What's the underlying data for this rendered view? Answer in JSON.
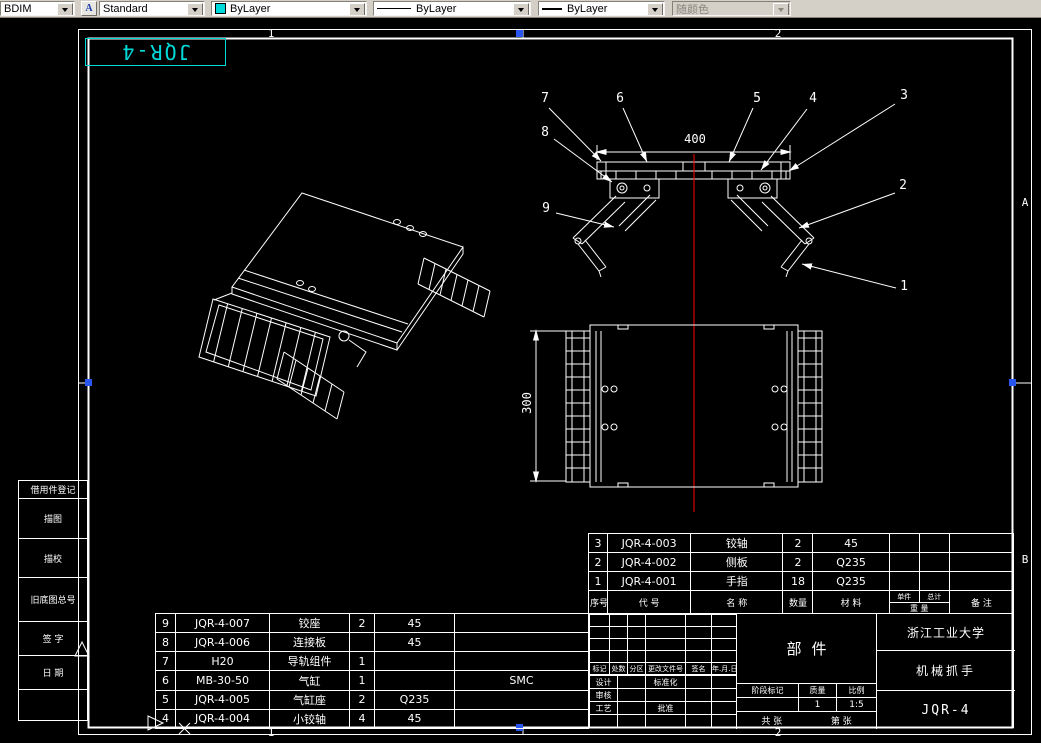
{
  "toolbar": {
    "dim_style": "BDIM",
    "text_style_icon": "A",
    "text_style": "Standard",
    "color": "ByLayer",
    "linetype": "ByLayer",
    "lineweight": "ByLayer",
    "plot_style": "随颜色"
  },
  "sheet": {
    "corner_label": "JQR-4",
    "zones_top": [
      "1",
      "2"
    ],
    "zones_bottom": [
      "1",
      "2"
    ],
    "zones_right": [
      "A",
      "B"
    ]
  },
  "dims": {
    "front_width": "400",
    "plan_depth": "300"
  },
  "balloons": [
    "1",
    "2",
    "3",
    "4",
    "5",
    "6",
    "7",
    "8",
    "9"
  ],
  "border_fields": [
    "借用件登记",
    "描图",
    "描校",
    "旧底图总号",
    "签 字",
    "日 期"
  ],
  "bom_left": {
    "rows": [
      [
        "9",
        "JQR-4-007",
        "铰座",
        "2",
        "45",
        ""
      ],
      [
        "8",
        "JQR-4-006",
        "连接板",
        "",
        "45",
        ""
      ],
      [
        "7",
        "H20",
        "导轨组件",
        "1",
        "",
        ""
      ],
      [
        "6",
        "MB-30-50",
        "气缸",
        "1",
        "",
        "SMC"
      ],
      [
        "5",
        "JQR-4-005",
        "气缸座",
        "2",
        "Q235",
        ""
      ],
      [
        "4",
        "JQR-4-004",
        "小铰轴",
        "4",
        "45",
        ""
      ]
    ]
  },
  "bom_right": {
    "rows": [
      [
        "3",
        "JQR-4-003",
        "铰轴",
        "2",
        "45",
        "",
        "",
        ""
      ],
      [
        "2",
        "JQR-4-002",
        "侧板",
        "2",
        "Q235",
        "",
        "",
        ""
      ],
      [
        "1",
        "JQR-4-001",
        "手指",
        "18",
        "Q235",
        "",
        "",
        ""
      ]
    ],
    "header": {
      "no": "序号",
      "code": "代 号",
      "name": "名 称",
      "qty": "数量",
      "material": "材 料",
      "unit": "单件",
      "total": "总计",
      "weight": "重 量",
      "note": "备 注"
    }
  },
  "title_block": {
    "revision_rows": [
      [
        "",
        "",
        "",
        "",
        "",
        ""
      ],
      [
        "",
        "",
        "",
        "",
        "",
        ""
      ],
      [
        "",
        "",
        "",
        "",
        "",
        ""
      ],
      [
        "",
        "",
        "",
        "",
        "",
        ""
      ],
      [
        "标记",
        "处数",
        "分区",
        "更改文件号",
        "签名",
        "年.月.日"
      ]
    ],
    "signature_rows": [
      [
        "设计",
        "",
        "标准化",
        "",
        ""
      ],
      [
        "审核",
        "",
        "",
        "",
        ""
      ],
      [
        "工艺",
        "",
        "批准",
        "",
        ""
      ],
      [
        "",
        "",
        "",
        "",
        ""
      ]
    ],
    "stage_label": "阶段标记",
    "mass_label": "质量",
    "scale_label": "比例",
    "mass_value": "1",
    "scale_value": "1:5",
    "sheet_total": "共 张",
    "sheet_no": "第 张",
    "type": "部件",
    "org": "浙江工业大学",
    "product": "机械抓手",
    "number": "JQR-4"
  }
}
